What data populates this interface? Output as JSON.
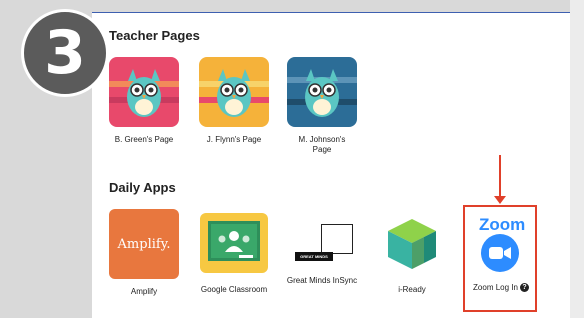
{
  "step_badge": "3",
  "teacher_pages": {
    "title": "Teacher Pages",
    "items": [
      {
        "label": "B. Green's Page",
        "bg": "#e8496b"
      },
      {
        "label": "J. Flynn's Page",
        "bg": "#f5b23a"
      },
      {
        "label": "M. Johnson's Page",
        "bg": "#2c6d97"
      }
    ]
  },
  "daily_apps": {
    "title": "Daily Apps",
    "items": [
      {
        "label": "Amplify",
        "logo_text": "Amplify."
      },
      {
        "label": "Google Classroom"
      },
      {
        "label": "Great Minds InSync",
        "logo_text": "GREAT MINDS"
      },
      {
        "label": "i-Ready"
      },
      {
        "label": "Zoom Log In",
        "logo_text": "Zoom"
      }
    ]
  },
  "colors": {
    "accent_red": "#e0402a",
    "zoom_blue": "#2d8cff"
  }
}
